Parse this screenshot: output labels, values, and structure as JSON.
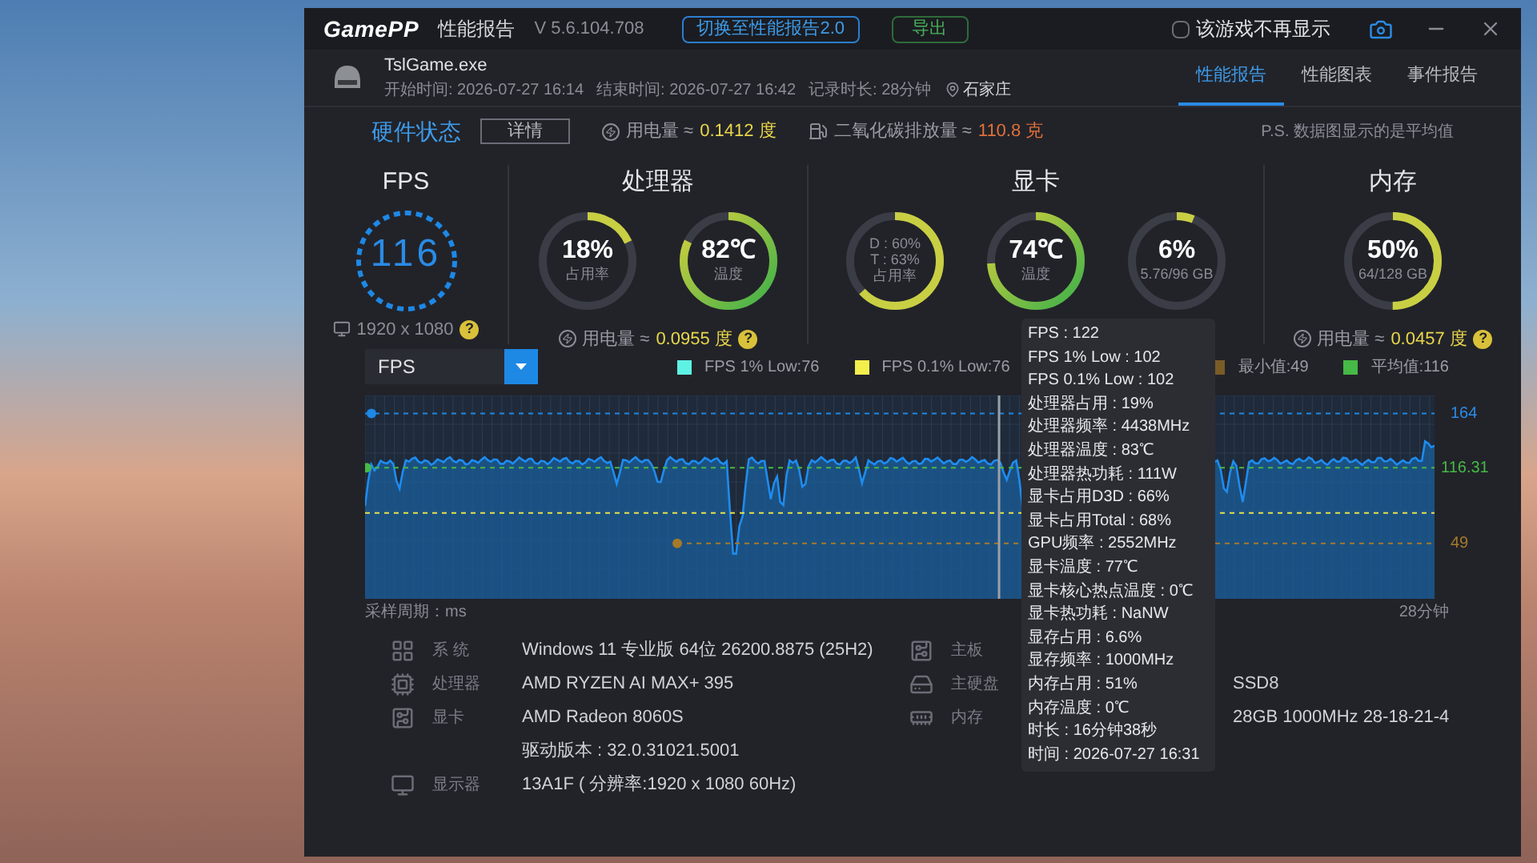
{
  "title_bar": {
    "logo": "GamePP",
    "title": "性能报告",
    "version": "V 5.6.104.708",
    "switch_button": "切换至性能报告2.0",
    "export_button": "导出",
    "dont_show": {
      "label": "该游戏不再显示",
      "checked": false
    }
  },
  "session": {
    "game": "TslGame.exe",
    "start": "开始时间: 2026-07-27 16:14",
    "end": "结束时间: 2026-07-27 16:42",
    "duration": "记录时长: 28分钟",
    "location": "石家庄"
  },
  "tabs": [
    {
      "label": "性能报告",
      "selected": true
    },
    {
      "label": "性能图表",
      "selected": false
    },
    {
      "label": "事件报告",
      "selected": false
    }
  ],
  "hardware_bar": {
    "title": "硬件状态",
    "details_button": "详情",
    "power": {
      "label": "用电量 ≈",
      "value": "0.1412 度"
    },
    "co2": {
      "label": "二氧化碳排放量 ≈",
      "value": "110.8 克"
    },
    "note": "P.S. 数据图显示的是平均值"
  },
  "fps_panel": {
    "title": "FPS",
    "value": "116",
    "resolution": "1920 x 1080",
    "help": "?"
  },
  "cpu_panel": {
    "title": "处理器",
    "gauges": [
      {
        "kind": "usage",
        "value": "18%",
        "label": "占用率",
        "level": 0.18
      },
      {
        "kind": "temp",
        "value": "82℃",
        "label": "温度",
        "level": 0.82
      }
    ],
    "power": {
      "label": "用电量 ≈",
      "value": "0.0955 度",
      "help": "?"
    }
  },
  "gpu_panel": {
    "title": "显卡",
    "gauges": [
      {
        "kind": "usage",
        "lines": [
          "D : 60%",
          "T : 63%"
        ],
        "label": "占用率",
        "level": 0.63
      },
      {
        "kind": "temp",
        "value": "74℃",
        "label": "温度",
        "level": 0.74
      },
      {
        "kind": "usage",
        "value": "6%",
        "label": "5.76/96 GB",
        "level": 0.06
      }
    ]
  },
  "memory_panel": {
    "title": "内存",
    "gauges": [
      {
        "kind": "usage",
        "value": "50%",
        "label": "64/128 GB",
        "level": 0.5
      }
    ],
    "power": {
      "label": "用电量 ≈",
      "value": "0.0457 度",
      "help": "?"
    }
  },
  "chart": {
    "metric_select": "FPS",
    "legend": [
      {
        "label": "FPS 1% Low:76",
        "color": "#5ef2e4"
      },
      {
        "label": "FPS 0.1% Low:76",
        "color": "#f2ef4c"
      },
      {
        "label": "最小值:49",
        "color": "#7a5c26"
      },
      {
        "label": "平均值:116",
        "color": "#46b946"
      }
    ],
    "max_label": "164",
    "avg_label": "116.31",
    "min_label": "49",
    "x_start": "采样周期：ms",
    "x_end": "28分钟"
  },
  "tooltip": [
    "FPS : 122",
    "FPS 1% Low : 102",
    "FPS 0.1% Low : 102",
    "处理器占用 : 19%",
    "处理器频率 : 4438MHz",
    "处理器温度 : 83℃",
    "处理器热功耗 : 111W",
    "显卡占用D3D : 66%",
    "显卡占用Total : 68%",
    "GPU频率 : 2552MHz",
    "显卡温度 : 77℃",
    "显卡核心热点温度 : 0℃",
    "显卡热功耗 : NaNW",
    "显存占用 : 6.6%",
    "显存频率 : 1000MHz",
    "内存占用 : 51%",
    "内存温度 : 0℃",
    "时长 : 16分钟38秒",
    "时间 : 2026-07-27 16:31"
  ],
  "system_info": {
    "left": [
      {
        "kind": "system",
        "label": "系 统",
        "value": "Windows 11 专业版 64位 26200.8875 (25H2)"
      },
      {
        "kind": "cpu",
        "label": "处理器",
        "value": "AMD RYZEN AI MAX+ 395"
      },
      {
        "kind": "gpu",
        "label": "显卡",
        "value": "AMD Radeon 8060S"
      },
      {
        "kind": "driver",
        "value": "驱动版本 : 32.0.31021.5001"
      },
      {
        "kind": "display",
        "label": "显示器",
        "value": "13A1F ( 分辨率:1920 x 1080 60Hz)"
      }
    ],
    "right": [
      {
        "kind": "board",
        "label": "主板"
      },
      {
        "kind": "disk",
        "label": "主硬盘",
        "value": "SSD8"
      },
      {
        "kind": "memory",
        "label": "内存",
        "value": "28GB 1000MHz 28-18-21-4"
      }
    ]
  }
}
